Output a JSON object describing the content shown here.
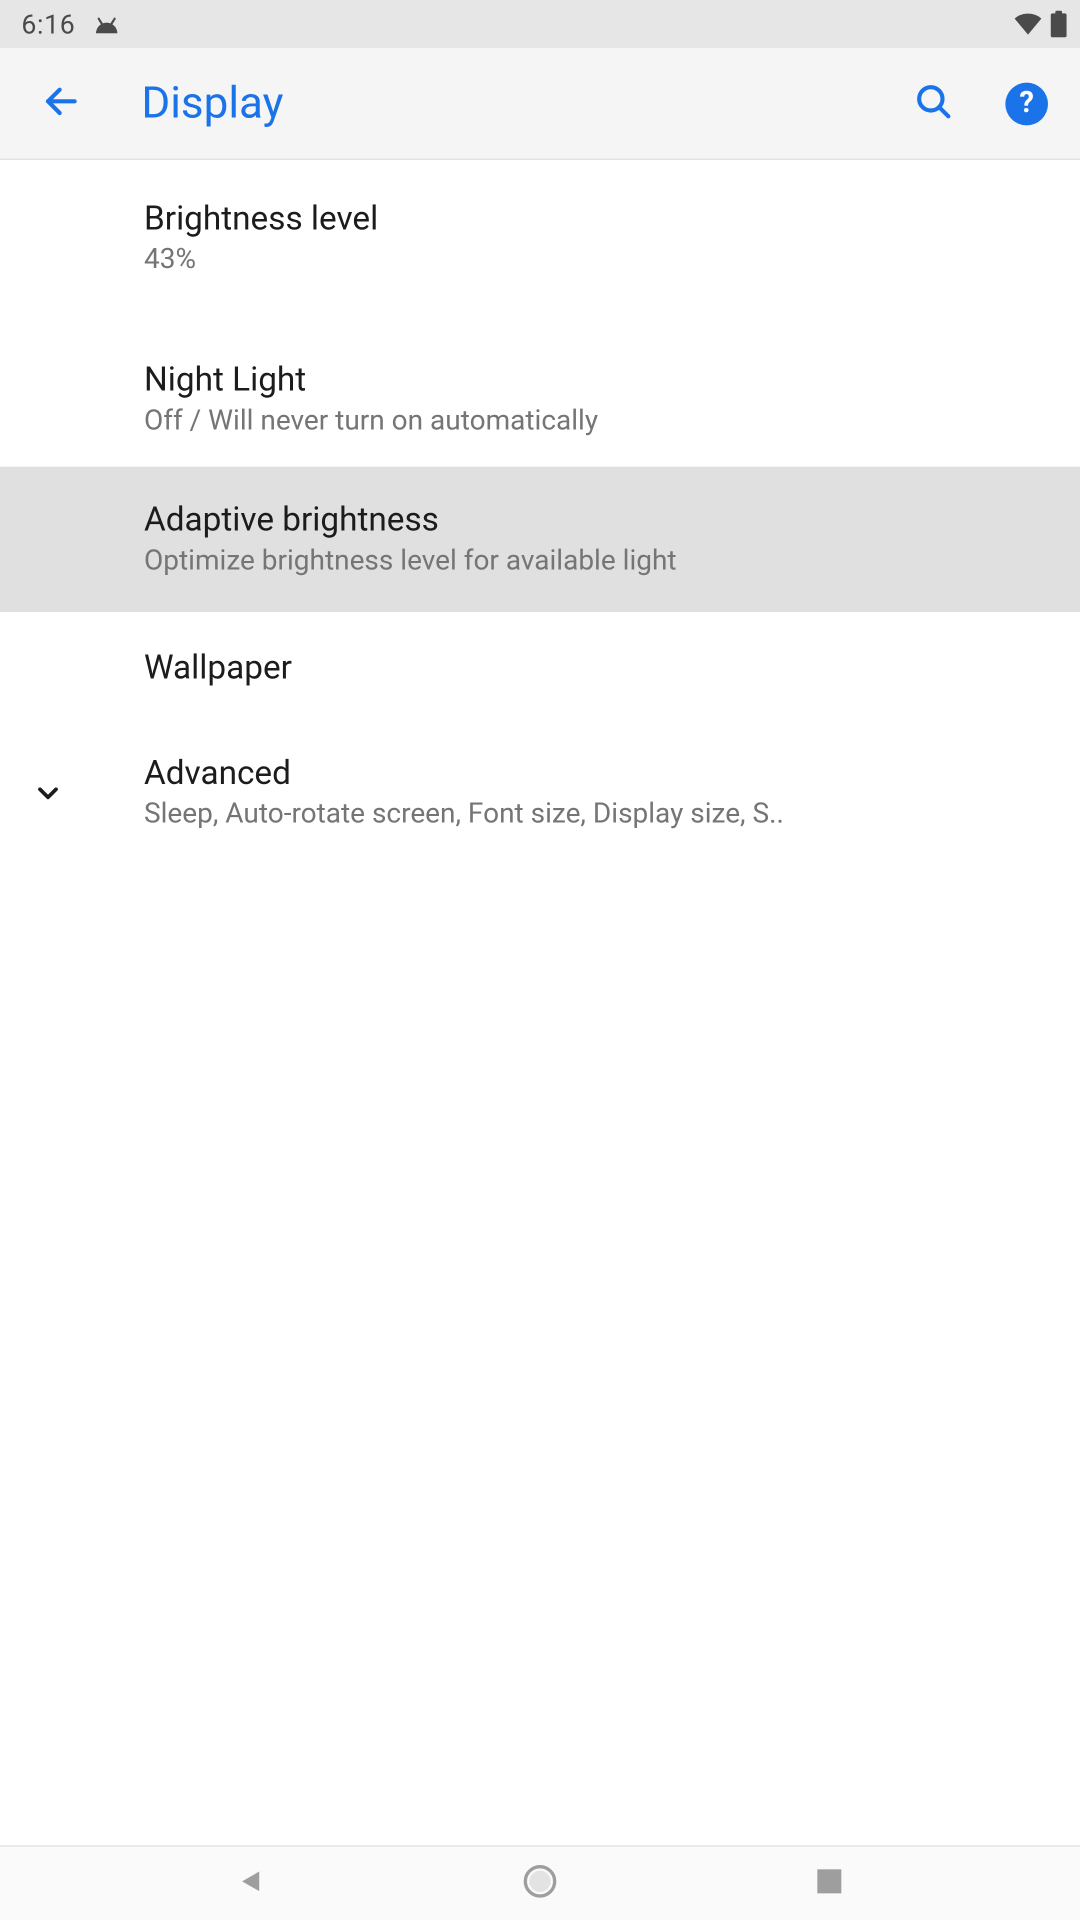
{
  "status": {
    "time": "6:16"
  },
  "header": {
    "title": "Display"
  },
  "settings": {
    "brightness": {
      "title": "Brightness level",
      "value": "43%"
    },
    "night_light": {
      "title": "Night Light",
      "sub": "Off / Will never turn on automatically"
    },
    "adaptive": {
      "title": "Adaptive brightness",
      "sub": "Optimize brightness level for available light"
    },
    "wallpaper": {
      "title": "Wallpaper"
    },
    "advanced": {
      "title": "Advanced",
      "sub": "Sleep, Auto-rotate screen, Font size, Display size, S.."
    }
  }
}
